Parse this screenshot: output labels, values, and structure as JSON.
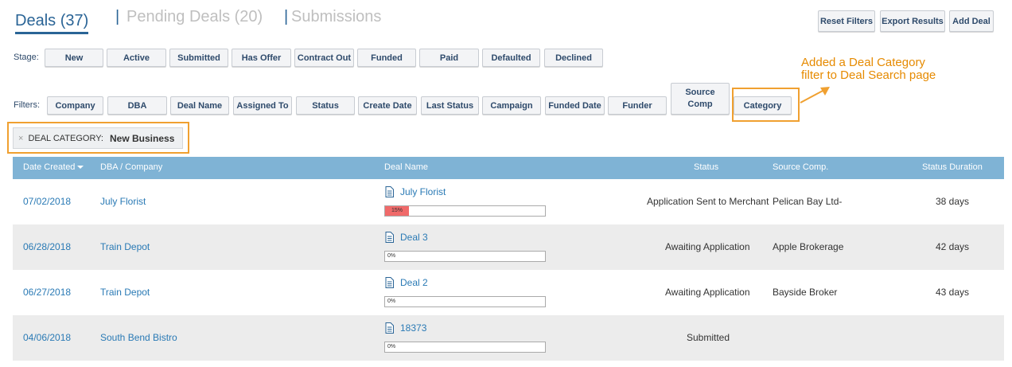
{
  "tabs": [
    {
      "label": "Deals (37)"
    },
    {
      "label": "Pending Deals (20)"
    },
    {
      "label": "Submissions"
    }
  ],
  "tab_separator": "|",
  "toolbar": {
    "reset_filters": "Reset Filters",
    "export_results": "Export Results",
    "add_deal": "Add Deal"
  },
  "stage": {
    "label": "Stage:",
    "buttons": [
      "New",
      "Active",
      "Submitted",
      "Has Offer",
      "Contract Out",
      "Funded",
      "Paid",
      "Defaulted",
      "Declined"
    ]
  },
  "filters": {
    "label": "Filters:",
    "buttons": [
      "Company",
      "DBA",
      "Deal Name",
      "Assigned To",
      "Status",
      "Create Date",
      "Last Status",
      "Campaign",
      "Funded Date",
      "Funder",
      "Source Comp",
      "Category"
    ],
    "source_comp_line1": "Source",
    "source_comp_line2": "Comp"
  },
  "annotation": {
    "line1": "Added a Deal Category",
    "line2": "filter to Deal Search page"
  },
  "active_filter": {
    "remove": "×",
    "key": "DEAL CATEGORY:",
    "value": "New Business"
  },
  "table": {
    "headers": {
      "date_created": "Date Created",
      "dba_company": "DBA / Company",
      "deal_name": "Deal Name",
      "status": "Status",
      "source_comp": "Source Comp.",
      "status_duration": "Status Duration"
    },
    "rows": [
      {
        "date": "07/02/2018",
        "company": "July Florist",
        "deal": "July Florist",
        "progress_label": "15%",
        "progress": 0.15,
        "status": "Application Sent to Merchant",
        "source": "Pelican Bay Ltd-",
        "duration": "38 days"
      },
      {
        "date": "06/28/2018",
        "company": "Train Depot",
        "deal": "Deal 3",
        "progress_label": "0%",
        "progress": 0,
        "status": "Awaiting Application",
        "source": "Apple Brokerage",
        "duration": "42 days"
      },
      {
        "date": "06/27/2018",
        "company": "Train Depot",
        "deal": "Deal 2",
        "progress_label": "0%",
        "progress": 0,
        "status": "Awaiting Application",
        "source": "Bayside Broker",
        "duration": "43 days"
      },
      {
        "date": "04/06/2018",
        "company": "South Bend Bistro",
        "deal": "18373",
        "progress_label": "0%",
        "progress": 0,
        "status": "Submitted",
        "source": "",
        "duration": ""
      }
    ]
  },
  "colors": {
    "accent": "#2a6496",
    "header_bg": "#7fb3d5",
    "annotation": "#e68a00",
    "progress_fill": "#f06a6a"
  }
}
